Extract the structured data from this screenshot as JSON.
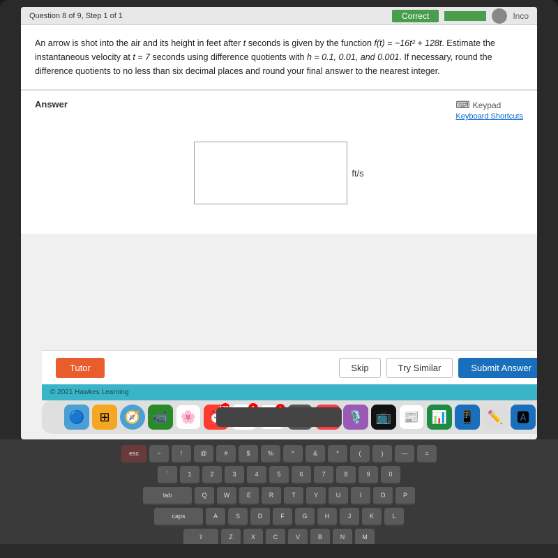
{
  "topbar": {
    "question_nav": "Question 8 of 9, Step 1 of 1",
    "correct_label": "Correct",
    "inco_label": "Inco"
  },
  "problem": {
    "text_parts": [
      "An arrow is shot into the air and its height in feet after ",
      "t",
      " seconds is given by the function ",
      "f(t) = −16t² + 128t",
      ". Estimate the instantaneous velocity at ",
      "t = 7",
      " seconds using difference quotients with ",
      "h = 0.1, 0.01, and 0.001",
      ". If necessary, round the difference quotients to no less than six decimal places and round your final answer to the nearest integer."
    ]
  },
  "answer_section": {
    "label": "Answer",
    "keypad_label": "Keypad",
    "keyboard_shortcuts_label": "Keyboard Shortcuts",
    "unit": "ft/s",
    "input_placeholder": ""
  },
  "buttons": {
    "tutor": "Tutor",
    "skip": "Skip",
    "try_similar": "Try Similar",
    "submit": "Submit Answer"
  },
  "footer": {
    "copyright": "© 2021 Hawkes Learning"
  },
  "dock": {
    "icons": [
      {
        "name": "finder",
        "emoji": "🔵",
        "badge": null
      },
      {
        "name": "launchpad",
        "emoji": "🟠",
        "badge": null
      },
      {
        "name": "facetime",
        "emoji": "🟢",
        "badge": null
      },
      {
        "name": "photos",
        "emoji": "🌸",
        "badge": null
      },
      {
        "name": "time-machine",
        "emoji": "⏰",
        "badge": null
      },
      {
        "name": "calendar",
        "emoji": "📅",
        "badge": "7"
      },
      {
        "name": "reminders",
        "emoji": "📋",
        "badge": "1"
      },
      {
        "name": "finder2",
        "emoji": "⬛",
        "badge": null
      },
      {
        "name": "music",
        "emoji": "🎵",
        "badge": null
      },
      {
        "name": "podcasts",
        "emoji": "🎙️",
        "badge": null
      },
      {
        "name": "apple-tv",
        "emoji": "📺",
        "badge": null
      },
      {
        "name": "news",
        "emoji": "📰",
        "badge": null
      },
      {
        "name": "numbers",
        "emoji": "📊",
        "badge": null
      },
      {
        "name": "ipad",
        "emoji": "📱",
        "badge": null
      },
      {
        "name": "pencil",
        "emoji": "✏️",
        "badge": null
      },
      {
        "name": "appstore",
        "emoji": "🅰️",
        "badge": null
      }
    ]
  },
  "keyboard": {
    "rows": [
      [
        "esc",
        "!",
        "@",
        "#",
        "$",
        "%",
        "^",
        "&",
        "*",
        "(",
        ")",
        "—",
        "="
      ],
      [
        "~",
        "1",
        "2",
        "3",
        "4",
        "5",
        "6",
        "7",
        "8",
        "9",
        "0"
      ],
      [
        "Q",
        "W",
        "E",
        "R",
        "T",
        "Y",
        "U",
        "I",
        "O",
        "P"
      ],
      [
        "A",
        "S",
        "D",
        "F",
        "G",
        "H",
        "J",
        "K",
        "L"
      ],
      [
        "Z",
        "X",
        "C",
        "V",
        "B",
        "N",
        "M"
      ]
    ]
  }
}
